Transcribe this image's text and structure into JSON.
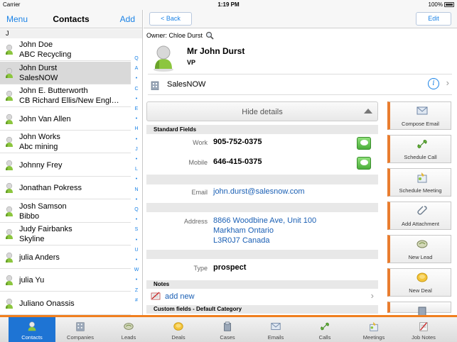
{
  "status_bar": {
    "carrier": "Carrier",
    "time": "1:19 PM",
    "battery": "100%"
  },
  "left": {
    "menu": "Menu",
    "title": "Contacts",
    "add": "Add",
    "section": "J",
    "contacts": [
      {
        "name": "John Doe",
        "company": "ABC Recycling",
        "selected": false
      },
      {
        "name": "John Durst",
        "company": "SalesNOW",
        "selected": true
      },
      {
        "name": "John E. Butterworth",
        "company": "CB Richard Ellis/New Engl…",
        "selected": false
      },
      {
        "name": "John Van Allen",
        "company": "",
        "selected": false
      },
      {
        "name": "John Works",
        "company": "Abc mining",
        "selected": false
      },
      {
        "name": "Johnny Frey",
        "company": "",
        "selected": false
      },
      {
        "name": "Jonathan Pokress",
        "company": "",
        "selected": false
      },
      {
        "name": "Josh Samson",
        "company": "Bibbo",
        "selected": false
      },
      {
        "name": "Judy Fairbanks",
        "company": "Skyline",
        "selected": false
      },
      {
        "name": "julia Anders",
        "company": "",
        "selected": false
      },
      {
        "name": "julia Yu",
        "company": "",
        "selected": false
      },
      {
        "name": "Juliano Onassis",
        "company": "",
        "selected": false
      }
    ],
    "index": [
      "Q",
      "A",
      "•",
      "C",
      "•",
      "E",
      "•",
      "H",
      "•",
      "J",
      "•",
      "L",
      "•",
      "N",
      "•",
      "Q",
      "•",
      "S",
      "•",
      "U",
      "•",
      "W",
      "•",
      "Z",
      "#"
    ]
  },
  "detail": {
    "back": "< Back",
    "edit": "Edit",
    "owner": "Owner: Chloe Durst",
    "name": "Mr John Durst",
    "title": "VP",
    "company": "SalesNOW",
    "hide_details": "Hide details",
    "standard_fields": "Standard Fields",
    "work_label": "Work",
    "work": "905-752-0375",
    "mobile_label": "Mobile",
    "mobile": "646-415-0375",
    "email_label": "Email",
    "email": "john.durst@salesnow.com",
    "address_label": "Address",
    "address_line1": "8866 Woodbine Ave, Unit 100",
    "address_line2": "Markham Ontario",
    "address_line3": "L3R0J7 Canada",
    "type_label": "Type",
    "type": "prospect",
    "notes": "Notes",
    "add_new": "add new",
    "custom_fields": "Custom fields - Default Category"
  },
  "actions": [
    "Compose Email",
    "Schedule Call",
    "Schedule Meeting",
    "Add Attachment",
    "New Lead",
    "New Deal"
  ],
  "tabs": [
    "Contacts",
    "Companies",
    "Leads",
    "Deals",
    "Cases",
    "Emails",
    "Calls",
    "Meetings",
    "Job Notes"
  ],
  "active_tab": "Contacts",
  "colors": {
    "accent": "#1a82e6",
    "selected_tab": "#1e74d4",
    "orange": "#f07f1f",
    "selected_row": "#d9d9d9"
  }
}
